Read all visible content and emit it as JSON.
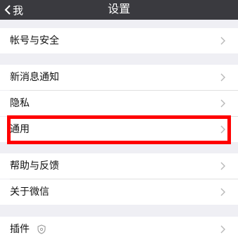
{
  "navbar": {
    "back_label": "我",
    "title": "设置"
  },
  "sections": [
    [
      {
        "label": "帐号与安全"
      }
    ],
    [
      {
        "label": "新消息通知"
      },
      {
        "label": "隐私"
      },
      {
        "label": "通用"
      }
    ],
    [
      {
        "label": "帮助与反馈"
      },
      {
        "label": "关于微信"
      }
    ],
    [
      {
        "label": "插件"
      }
    ]
  ],
  "highlight_color": "#ff0000",
  "icons": [
    "chevron-left-icon",
    "chevron-right-icon",
    "plugin-shield-icon"
  ]
}
